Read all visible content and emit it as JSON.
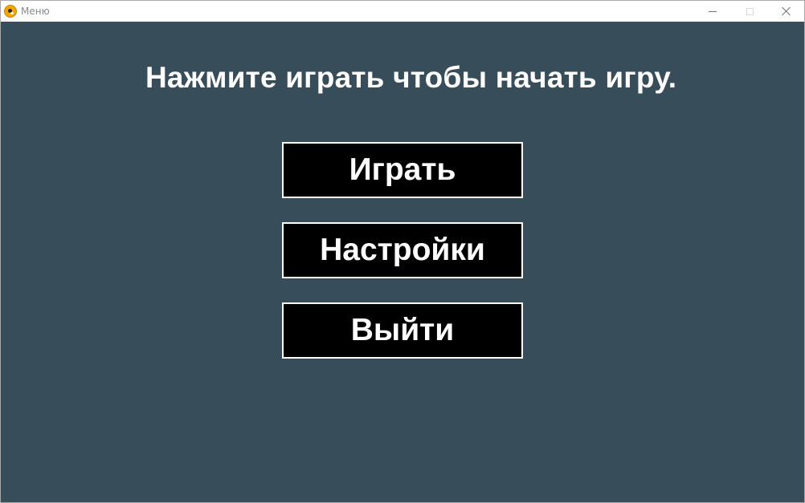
{
  "window": {
    "title": "Меню",
    "app_icon": "pygame-snake-icon",
    "controls": {
      "minimize_icon": "minimize-icon",
      "maximize_icon": "maximize-icon",
      "close_icon": "close-icon"
    }
  },
  "game": {
    "background_color": "#374d5a",
    "headline": "Нажмите играть чтобы начать игру.",
    "menu": {
      "buttons": [
        {
          "label": "Играть"
        },
        {
          "label": "Настройки"
        },
        {
          "label": "Выйти"
        }
      ],
      "button_fill": "#000000",
      "button_border": "#ffffff",
      "text_color": "#ffffff"
    }
  }
}
